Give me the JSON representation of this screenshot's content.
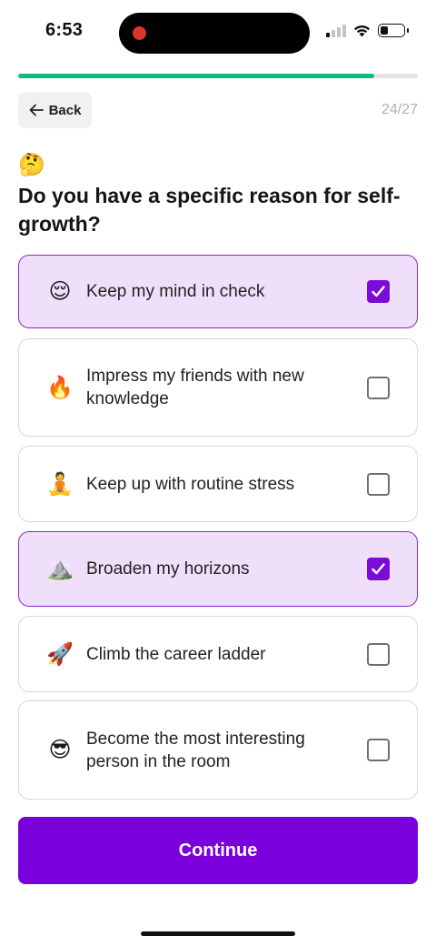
{
  "status_bar": {
    "time": "6:53",
    "icons": [
      "cellular-signal-icon",
      "wifi-icon",
      "battery-icon"
    ]
  },
  "progress": {
    "fraction": 0.89
  },
  "nav": {
    "back_label": "Back",
    "step_counter": "24/27"
  },
  "question": {
    "emoji": "🤔",
    "title": "Do you have a specific reason for self-growth?"
  },
  "options": [
    {
      "emoji": "😌",
      "label": "Keep my mind in check",
      "checked": true
    },
    {
      "emoji": "🔥",
      "label": "Impress my friends with new knowledge",
      "checked": false
    },
    {
      "emoji": "🧘",
      "label": "Keep up with routine stress",
      "checked": false
    },
    {
      "emoji": "⛰️",
      "label": "Broaden my horizons",
      "checked": true
    },
    {
      "emoji": "🚀",
      "label": "Climb the career ladder",
      "checked": false
    },
    {
      "emoji": "😎",
      "label": "Become the most interesting person in the room",
      "checked": false
    }
  ],
  "continue_label": "Continue",
  "colors": {
    "accent": "#7a00db",
    "progress": "#10b981",
    "selected_bg": "#f0dffb",
    "selected_border": "#8b26c5"
  }
}
